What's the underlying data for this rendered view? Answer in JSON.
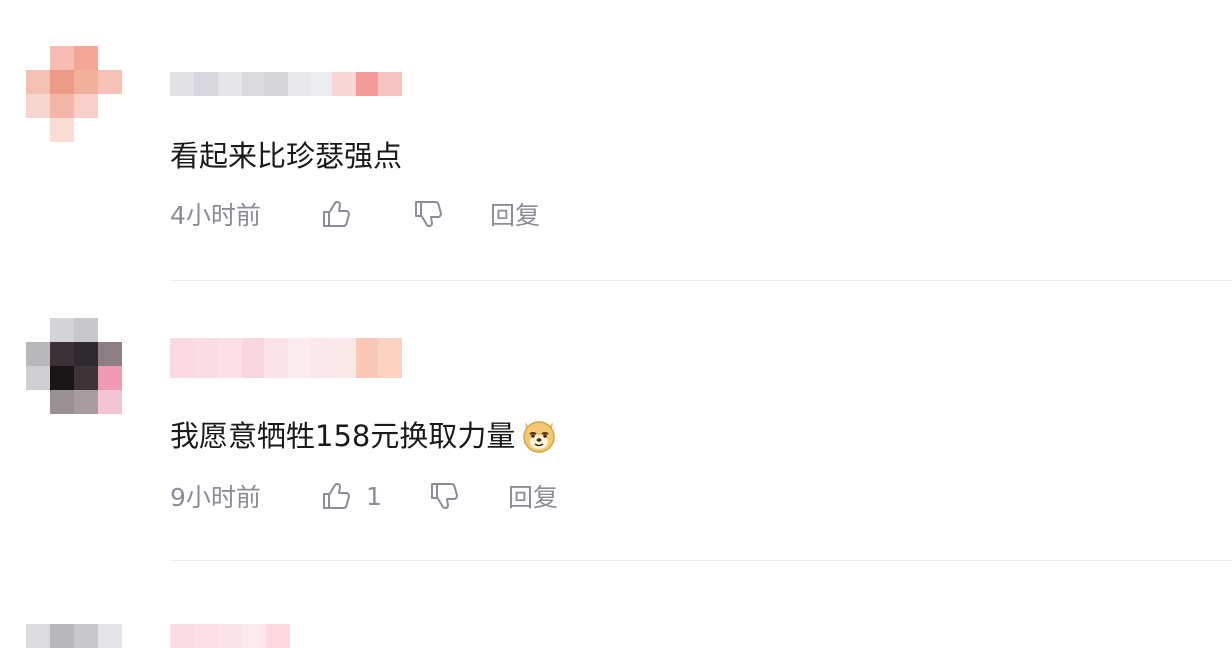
{
  "comments": [
    {
      "avatar_colors": [
        "#ffffff",
        "#f7bdb3",
        "#f4a595",
        "#ffffff",
        "#f5c0b4",
        "#ef9a88",
        "#f0b09a",
        "#f6c2b8",
        "#f6d5cf",
        "#f2b5a8",
        "#f8cfc8",
        "#ffffff",
        "#ffffff",
        "#f8dcd6",
        "#ffffff",
        "#ffffff"
      ],
      "name_colors": [
        "#e2e2e6",
        "#d6d6dc",
        "#e6e6ea",
        "#dadade",
        "#d6d6da",
        "#e8e8ec",
        "#ececef",
        "#f6d6d6",
        "#f39a9a",
        "#f7c2c2"
      ],
      "text": "看起来比珍瑟强点",
      "time": "4小时前",
      "like_count": "",
      "reply_label": "回复"
    },
    {
      "avatar_colors": [
        "#ffffff",
        "#d4d4d8",
        "#c8c8cc",
        "#ffffff",
        "#b8b8bc",
        "#3a3236",
        "#2e2a30",
        "#8c7e84",
        "#cfcfd3",
        "#1a1618",
        "#3e3438",
        "#f19ab4",
        "#ffffff",
        "#9a9094",
        "#a89ca0",
        "#f3c4d2"
      ],
      "name_colors": [
        "#fbd9e0",
        "#fadce3",
        "#fbe0e5",
        "#f9d6de",
        "#fae2e7",
        "#fcebee",
        "#fbe7ea",
        "#fbe9ea",
        "#f9c7b4",
        "#fbd1c0"
      ],
      "text": "我愿意牺牲158元换取力量",
      "time": "9小时前",
      "like_count": "1",
      "reply_label": "回复"
    },
    {
      "avatar_colors": [
        "#dcdce0",
        "#b8b8bc",
        "#c8c8cc",
        "#e4e4e8"
      ],
      "name_colors": [
        "#fbdbe2",
        "#fadfe5",
        "#fbe3e8",
        "#fde9ec",
        "#fcd8dc"
      ]
    }
  ]
}
